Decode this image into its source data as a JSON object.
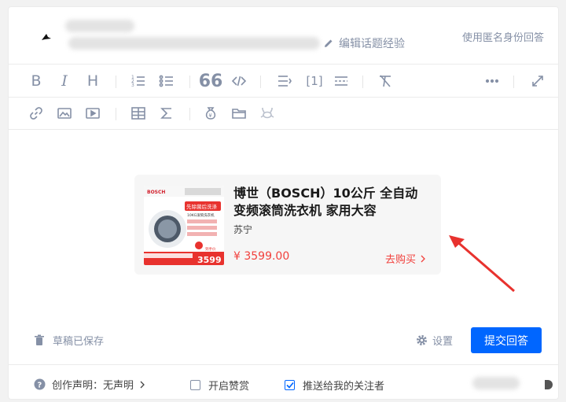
{
  "header": {
    "edit_experience": "编辑话题经验",
    "anonymous": "使用匿名身份回答"
  },
  "toolbar": {
    "heading_label": "H",
    "footnote_label": "[1]"
  },
  "product": {
    "title": "博世（BOSCH）10公斤 全自动变频滚筒洗衣机 家用大容",
    "store": "苏宁",
    "price": "¥ 3599.00",
    "buy_label": "去购买",
    "thumb_brand": "BOSCH",
    "thumb_tag": "先除菌后洗涤",
    "thumb_sub": "10KG滚筒洗衣机",
    "thumb_price": "3599",
    "thumb_promo": "到手价"
  },
  "footer": {
    "draft_saved": "草稿已保存",
    "settings": "设置",
    "submit": "提交回答",
    "declaration": "创作声明：无声明",
    "enable_likes": "开启赞赏",
    "push_followers": "推送给我的关注者"
  },
  "colors": {
    "primary": "#0066ff",
    "price": "#f1403c",
    "muted": "#8590a6",
    "arrow": "#e8322e"
  }
}
